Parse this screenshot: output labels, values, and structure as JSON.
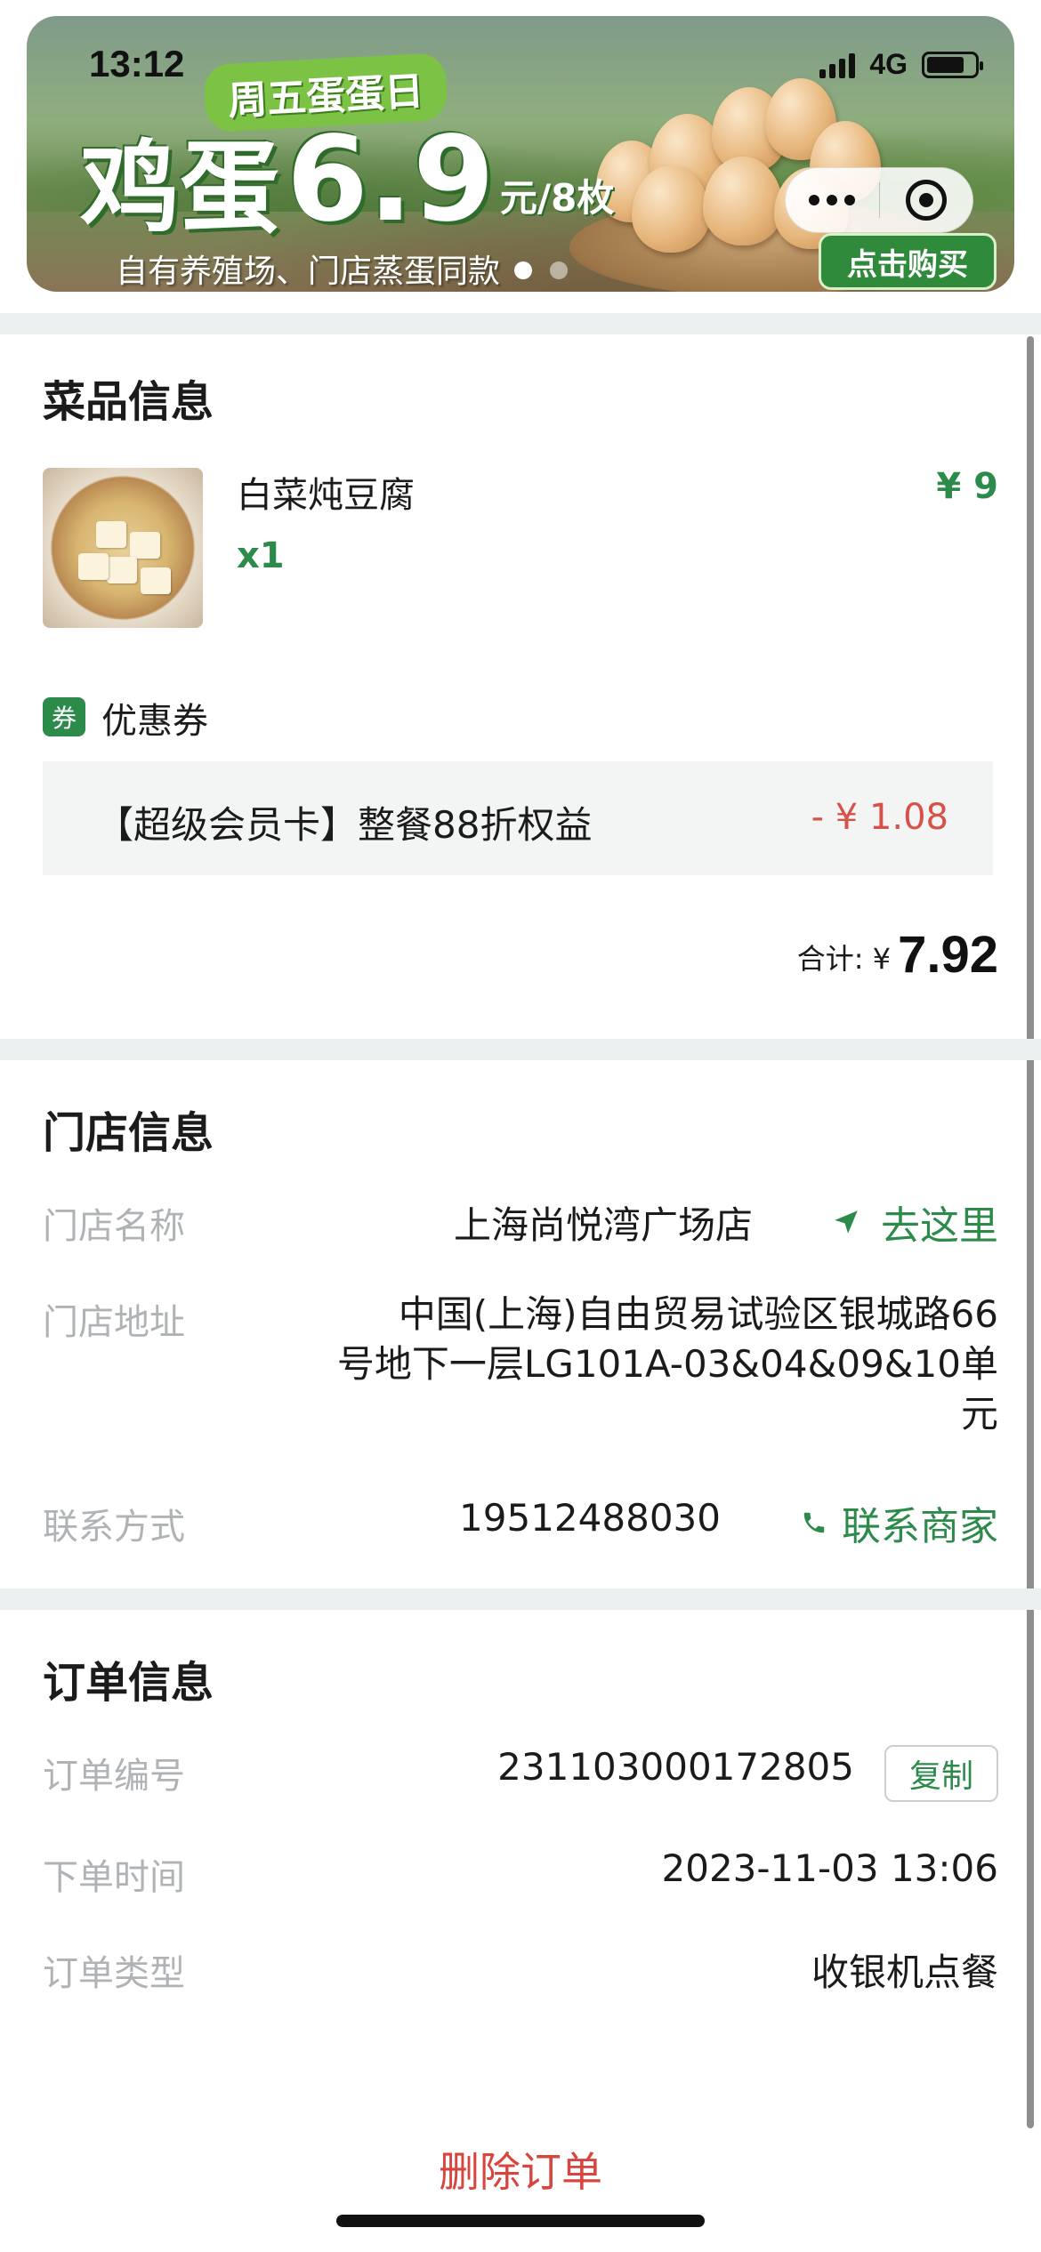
{
  "status_bar": {
    "time": "13:12",
    "network": "4G"
  },
  "banner": {
    "tag": "周五蛋蛋日",
    "headline": "鸡蛋",
    "price": "6.9",
    "unit": "元/8枚",
    "subtitle": "自有养殖场、门店蒸蛋同款",
    "buy_label": "点击购买"
  },
  "dish_section": {
    "title": "菜品信息",
    "dish": {
      "name": "白菜炖豆腐",
      "qty": "x1",
      "price": "¥ 9"
    },
    "coupon": {
      "label": "优惠券",
      "icon_char": "券",
      "name": "【超级会员卡】整餐88折权益",
      "amount": "- ¥ 1.08"
    },
    "total": {
      "label": "合计: ¥",
      "value": "7.92"
    }
  },
  "store_section": {
    "title": "门店信息",
    "name_label": "门店名称",
    "name": "上海尚悦湾广场店",
    "navigate": "去这里",
    "address_label": "门店地址",
    "address_lines": [
      "中国(上海)自由贸易试验区银城路66",
      "号地下一层LG101A-03&04&09&10单",
      "元"
    ],
    "contact_label": "联系方式",
    "phone": "19512488030",
    "contact_action": "联系商家"
  },
  "order_section": {
    "title": "订单信息",
    "number_label": "订单编号",
    "number": "231103000172805",
    "copy_label": "复制",
    "time_label": "下单时间",
    "time": "2023-11-03 13:06",
    "type_label": "订单类型",
    "type": "收银机点餐"
  },
  "delete_label": "删除订单",
  "colors": {
    "accent_green": "#2c8a4b",
    "danger_red": "#d7453e",
    "gap_bg": "#eaf1f0"
  }
}
